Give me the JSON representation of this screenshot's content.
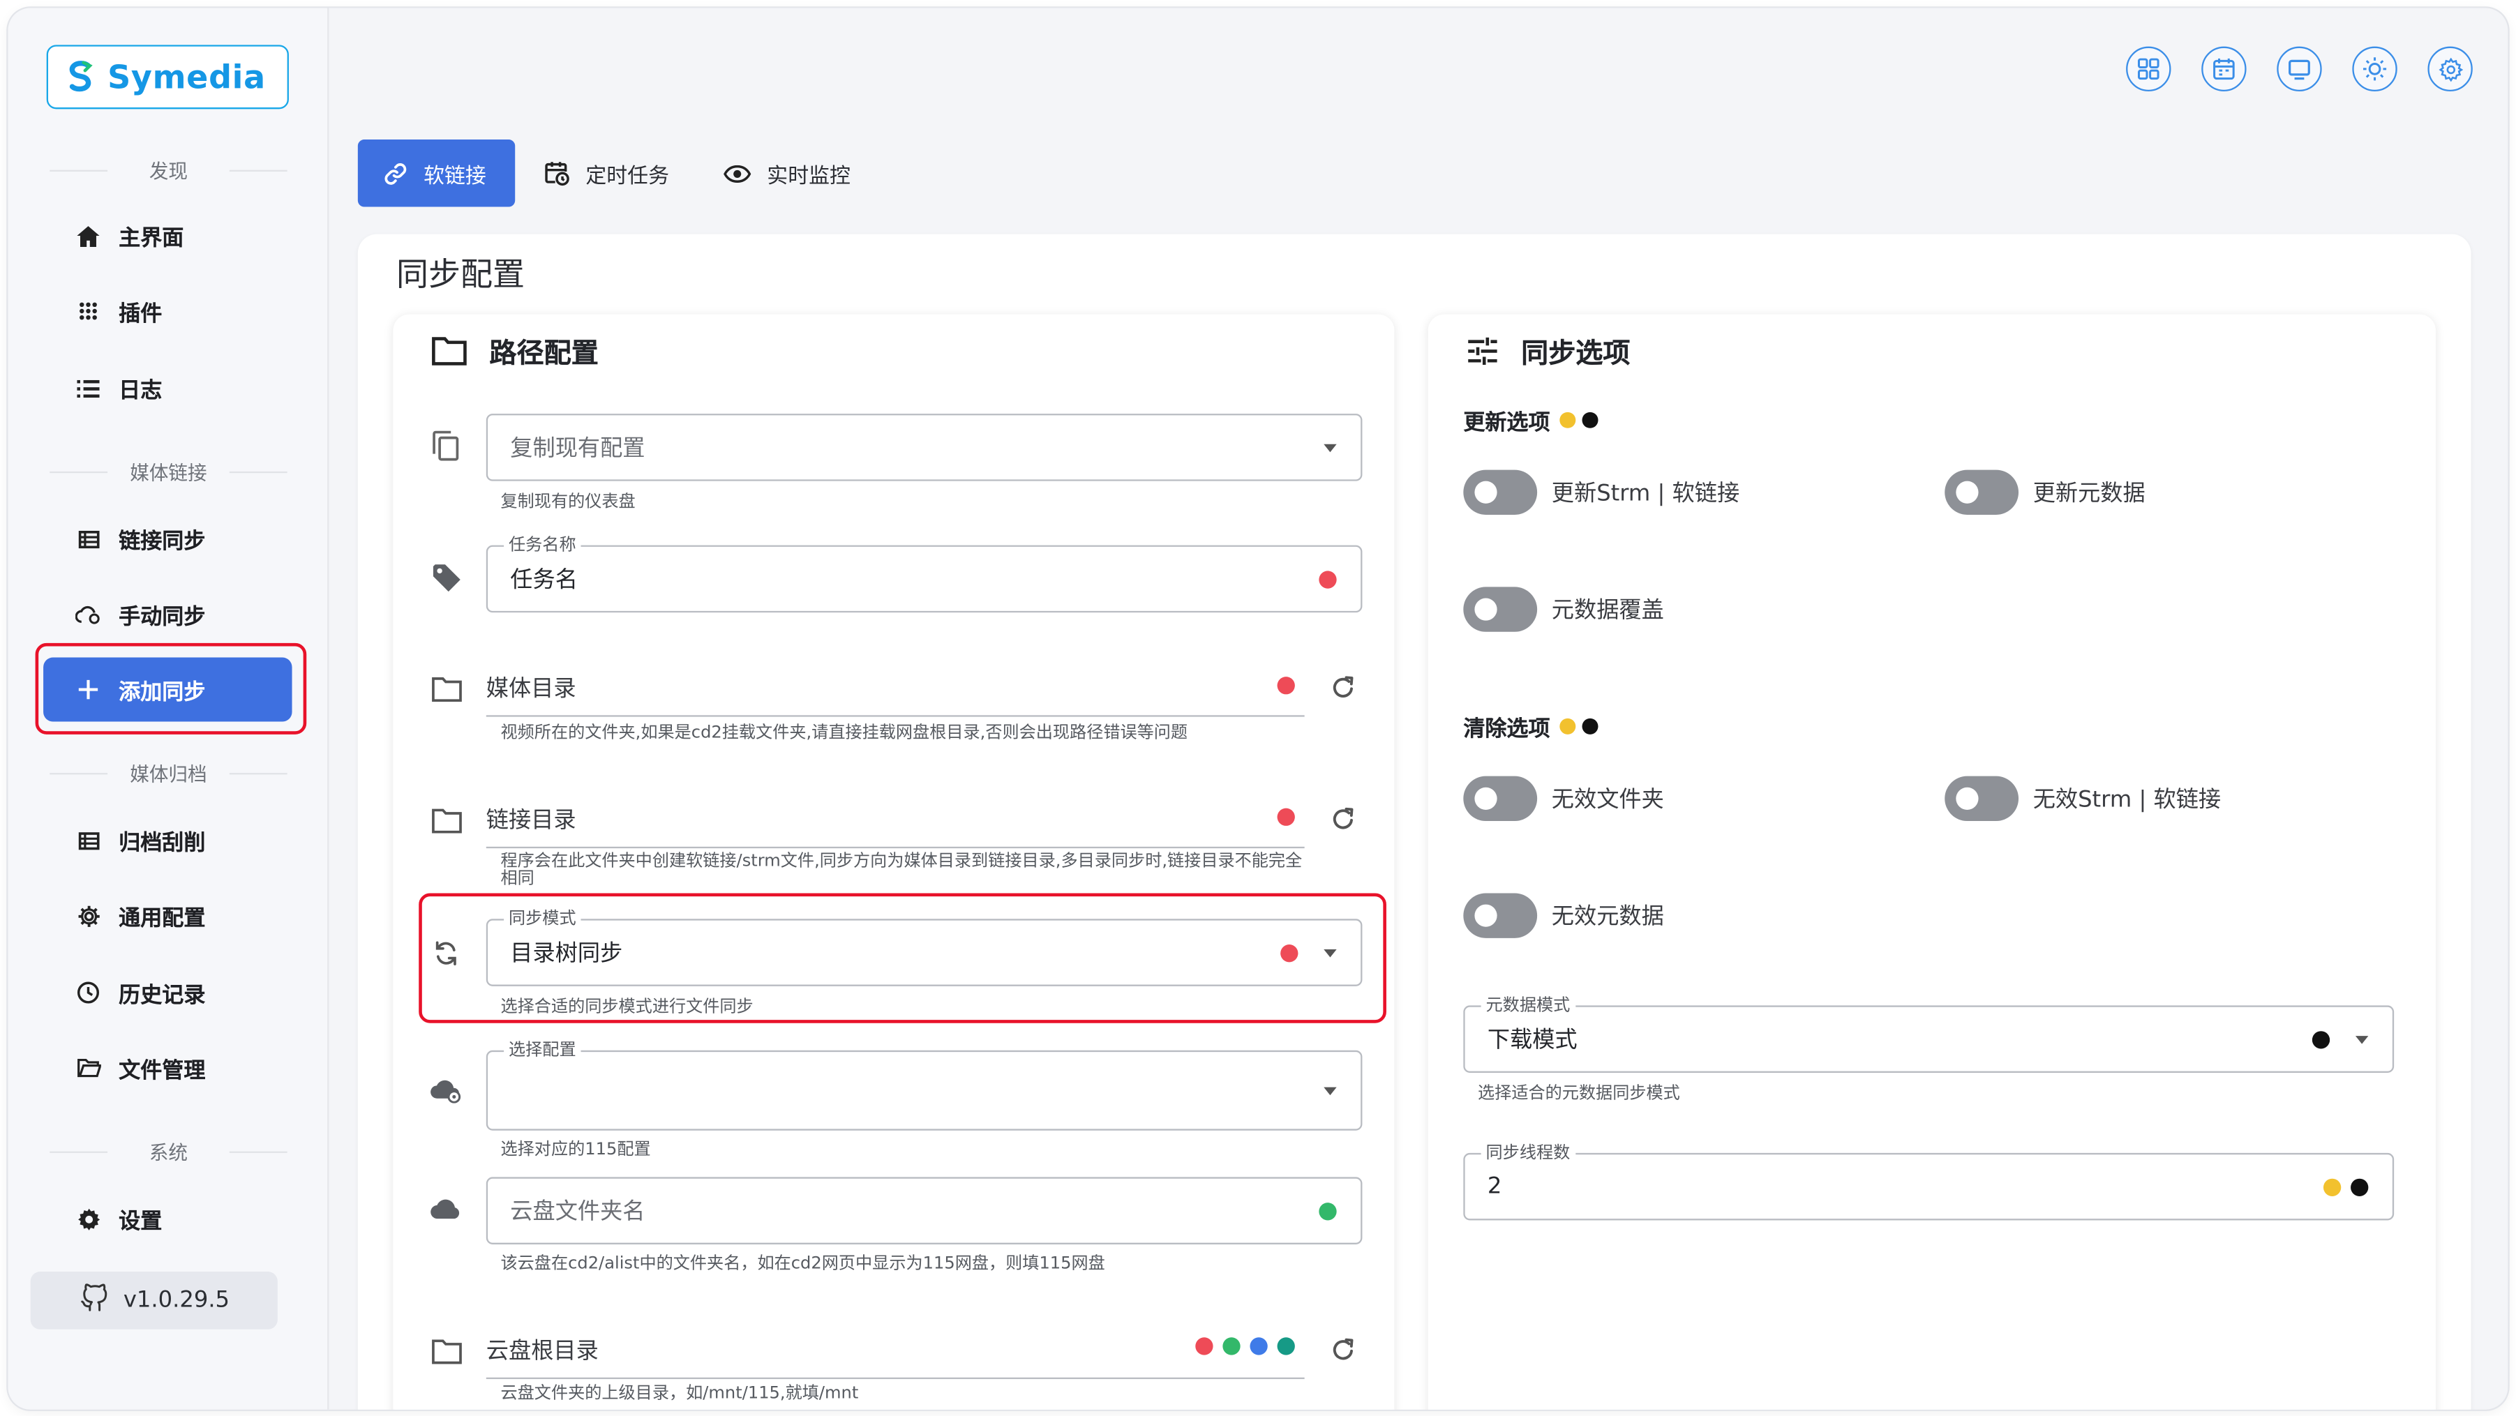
{
  "app": {
    "logo_text": "Symedia",
    "version": "v1.0.29.5"
  },
  "sidebar": {
    "sections": {
      "discover": "发现",
      "media_link": "媒体链接",
      "media_archive": "媒体归档",
      "system": "系统"
    },
    "items": {
      "home": "主界面",
      "plugins": "插件",
      "logs": "日志",
      "link_sync": "链接同步",
      "manual_sync": "手动同步",
      "add_sync": "添加同步",
      "archive_scrape": "归档刮削",
      "general_config": "通用配置",
      "history": "历史记录",
      "file_manager": "文件管理",
      "settings": "设置"
    }
  },
  "tabs": {
    "symlink": "软链接",
    "scheduled": "定时任务",
    "monitor": "实时监控"
  },
  "page_title": "同步配置",
  "path_config": {
    "title": "路径配置",
    "copy_config": {
      "placeholder": "复制现有配置",
      "help": "复制现有的仪表盘"
    },
    "task_name": {
      "label": "任务名称",
      "value": "任务名"
    },
    "media_dir": {
      "placeholder": "媒体目录",
      "help": "视频所在的文件夹,如果是cd2挂载文件夹,请直接挂载网盘根目录,否则会出现路径错误等问题"
    },
    "link_dir": {
      "placeholder": "链接目录",
      "help": "程序会在此文件夹中创建软链接/strm文件,同步方向为媒体目录到链接目录,多目录同步时,链接目录不能完全相同"
    },
    "sync_mode": {
      "label": "同步模式",
      "value": "目录树同步",
      "help": "选择合适的同步模式进行文件同步"
    },
    "select_config": {
      "label": "选择配置",
      "value": "",
      "help": "选择对应的115配置"
    },
    "cloud_folder": {
      "placeholder": "云盘文件夹名",
      "help": "该云盘在cd2/alist中的文件夹名，如在cd2网页中显示为115网盘，则填115网盘"
    },
    "cloud_root": {
      "placeholder": "云盘根目录",
      "help": "云盘文件夹的上级目录，如/mnt/115,就填/mnt"
    }
  },
  "sync_options": {
    "title": "同步选项",
    "update_heading": "更新选项",
    "update_strm": "更新Strm | 软链接",
    "update_meta": "更新元数据",
    "meta_overwrite": "元数据覆盖",
    "clean_heading": "清除选项",
    "invalid_folder": "无效文件夹",
    "invalid_strm": "无效Strm | 软链接",
    "invalid_meta": "无效元数据",
    "meta_mode": {
      "label": "元数据模式",
      "value": "下载模式",
      "help": "选择适合的元数据同步模式"
    },
    "threads": {
      "label": "同步线程数",
      "value": "2"
    }
  },
  "colors": {
    "accent": "#3e70e0",
    "highlight": "#e8122a",
    "dot_red": "#ee4b57",
    "dot_green": "#33b86a",
    "dot_yellow": "#f2c12e",
    "dot_blue": "#3f7be8",
    "dot_teal": "#169a86",
    "dot_black": "#111111"
  },
  "icons": {
    "top": [
      "apps-icon",
      "calendar-icon",
      "monitor-icon",
      "brightness-icon",
      "gear-icon"
    ]
  }
}
